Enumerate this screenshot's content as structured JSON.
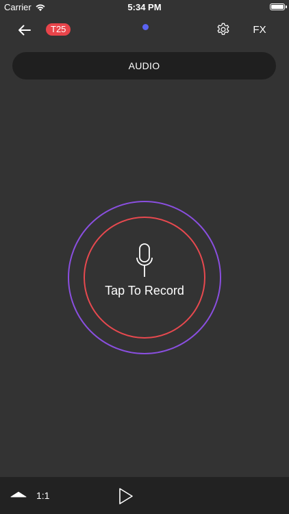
{
  "status_bar": {
    "carrier": "Carrier",
    "time": "5:34 PM",
    "wifi_icon": "wifi-icon",
    "battery_icon": "battery-icon"
  },
  "toolbar": {
    "back_icon": "arrow-left-icon",
    "badge": "T25",
    "settings_icon": "gear-icon",
    "fx_label": "FX"
  },
  "tabs": {
    "items": [
      {
        "label": "AUDIO",
        "selected": true
      }
    ]
  },
  "record": {
    "label": "Tap To Record",
    "mic_icon": "microphone-icon"
  },
  "bottom_bar": {
    "collapse_icon": "chevron-up-icon",
    "aspect_ratio": "1:1",
    "play_icon": "play-icon"
  },
  "colors": {
    "background": "#333333",
    "tabbar": "#1f1f1f",
    "badge": "#e8444a",
    "outer_ring": "#8a4fe0",
    "inner_ring": "#e8494f",
    "tab_indicator": "#5a63f2",
    "bottom_bar": "#222222"
  }
}
